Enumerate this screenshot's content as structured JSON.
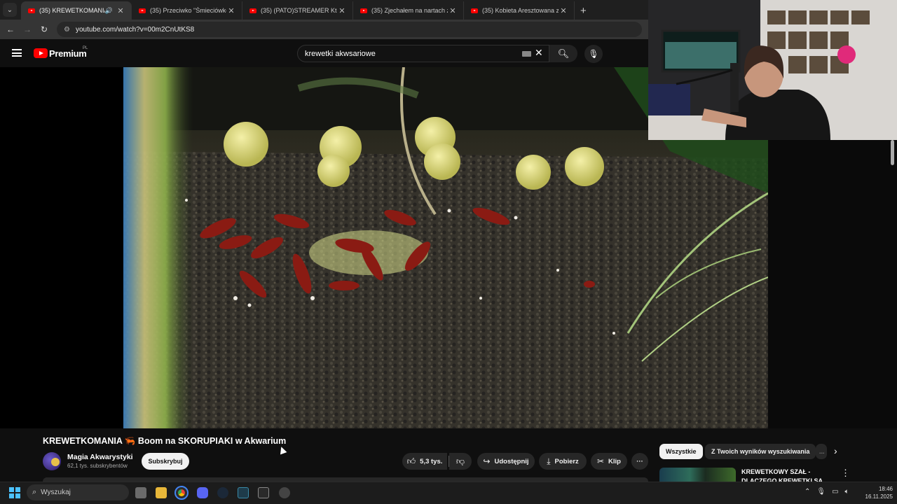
{
  "browser": {
    "tabs": [
      {
        "title": "(35) KREWETKOMANIA 🦐",
        "active": true,
        "audio": true
      },
      {
        "title": "(35) Przeciwko \"Śmieciówkom\"",
        "active": false
      },
      {
        "title": "(35) (PATO)STREAMER Który Ni",
        "active": false
      },
      {
        "title": "(35) Zjechałem na nartach z Mo",
        "active": false
      },
      {
        "title": "(35) Kobieta Aresztowana za Uj",
        "active": false
      }
    ],
    "new_tab": "+",
    "url": "youtube.com/watch?v=00m2CnUtKS8"
  },
  "youtube": {
    "brand": "Premium",
    "country": "PL",
    "search_value": "krewetki akwsariowe"
  },
  "video": {
    "title": "KREWETKOMANIA 🦐 Boom na SKORUPIAKI w Akwarium",
    "channel": "Magia Akwarystyki",
    "subscribers": "62,1 tys. subskrybentów",
    "subscribe_label": "Subskrybuj",
    "likes": "5,3 tys.",
    "share_label": "Udostępnij",
    "download_label": "Pobierz",
    "clip_label": "Klip",
    "more": "···"
  },
  "sidebar": {
    "chips": [
      "Wszystkie",
      "Z Twoich wyników wyszukiwania",
      "..."
    ],
    "related": [
      {
        "title": "KREWETKOWY SZAŁ - DLACZEGO KREWETKI SĄ"
      }
    ]
  },
  "taskbar": {
    "search_placeholder": "Wyszukaj",
    "time": "18:46",
    "date": "16.11.2025"
  },
  "colors": {
    "accent": "#ff0000",
    "background": "#0f0f0f",
    "windows_blue": "#4cc2ff"
  }
}
